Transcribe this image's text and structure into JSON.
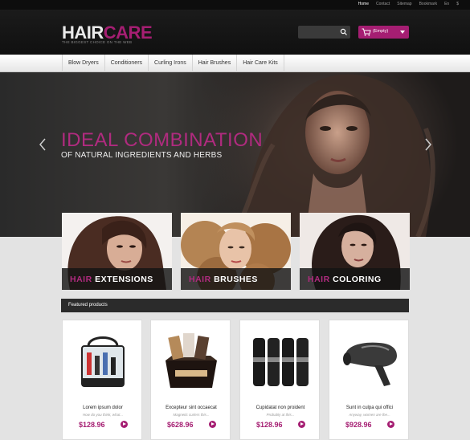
{
  "topbar": {
    "links": [
      "Home",
      "Contact",
      "Sitemap",
      "Bookmark",
      "En",
      "$"
    ]
  },
  "header": {
    "logo_part1": "HAIR",
    "logo_part2": "CARE",
    "tagline": "THE BIGGEST CHOICE ON THE WEB",
    "cart_label": "(Empty)"
  },
  "nav": {
    "items": [
      "Blow Dryers",
      "Conditioners",
      "Curling Irons",
      "Hair Brushes",
      "Hair Care Kits"
    ]
  },
  "hero": {
    "title": "IDEAL COMBINATION",
    "subtitle": "OF NATURAL INGREDIENTS AND HERBS"
  },
  "categories": [
    {
      "keyword": "HAIR",
      "rest": "EXTENSIONS"
    },
    {
      "keyword": "HAIR",
      "rest": "BRUSHES"
    },
    {
      "keyword": "HAIR",
      "rest": "COLORING"
    }
  ],
  "featured": {
    "title": "Featured products",
    "products": [
      {
        "name": "Lorem ipsum dolor",
        "desc": "How do you think, what...",
        "price": "$128.96",
        "image": "bag-icon"
      },
      {
        "name": "Excepteur sint occaecat",
        "desc": "Magnetic curlers this...",
        "price": "$628.96",
        "image": "kit-box-icon"
      },
      {
        "name": "Cupidatat non proident",
        "desc": "Probably at this...",
        "price": "$128.96",
        "image": "bottles-icon"
      },
      {
        "name": "Sunt in culpa qui offici",
        "desc": "Anyway, women are the...",
        "price": "$928.96",
        "image": "hair-dryer-icon"
      }
    ]
  },
  "colors": {
    "accent": "#a51e72",
    "dark": "#1b1b1b"
  }
}
